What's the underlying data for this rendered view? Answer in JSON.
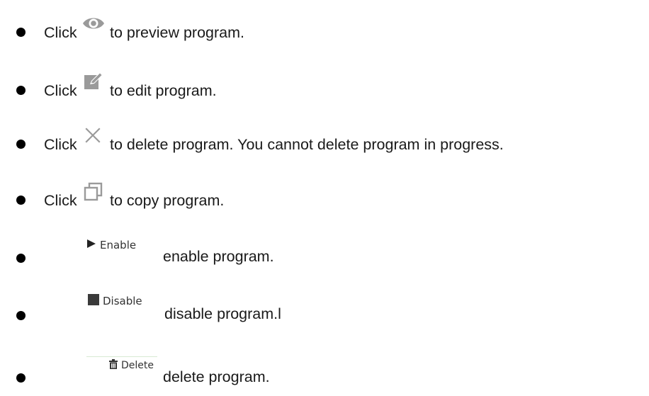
{
  "items": [
    {
      "prefix": "Click",
      "suffix": "to preview program.",
      "icon": "eye-icon"
    },
    {
      "prefix": "Click",
      "suffix": "to edit program.",
      "icon": "edit-icon"
    },
    {
      "prefix": "Click",
      "suffix": "to delete program. You cannot delete program in progress.",
      "icon": "close-icon"
    },
    {
      "prefix": "Click",
      "suffix": "to copy program.",
      "icon": "copy-icon"
    },
    {
      "button_label": "Enable",
      "suffix": "enable program.",
      "icon": "play-icon"
    },
    {
      "button_label": "Disable",
      "suffix": "disable program.l",
      "icon": "stop-icon"
    },
    {
      "button_label": "Delete",
      "suffix": "delete program.",
      "icon": "trash-icon"
    }
  ],
  "colors": {
    "icon_gray": "#9a9a9a",
    "button_text": "#333333",
    "delete_border": "#d7ead3"
  }
}
